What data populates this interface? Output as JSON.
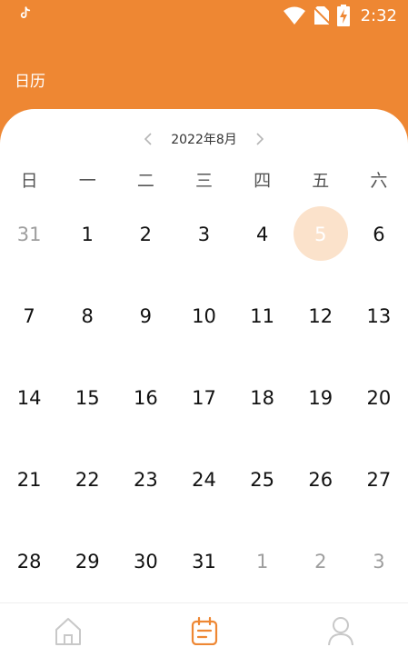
{
  "status_bar": {
    "time": "2:32"
  },
  "header": {
    "title": "日历"
  },
  "calendar": {
    "month_label": "2022年8月",
    "weekdays": [
      "日",
      "一",
      "二",
      "三",
      "四",
      "五",
      "六"
    ],
    "selected_day": "5",
    "days": [
      "31",
      "1",
      "2",
      "3",
      "4",
      "5",
      "6",
      "7",
      "8",
      "9",
      "10",
      "11",
      "12",
      "13",
      "14",
      "15",
      "16",
      "17",
      "18",
      "19",
      "20",
      "21",
      "22",
      "23",
      "24",
      "25",
      "26",
      "27",
      "28",
      "29",
      "30",
      "31",
      "1",
      "2",
      "3"
    ]
  },
  "colors": {
    "accent": "#EE8733",
    "selected_bg": "#FBE2CB",
    "muted_text": "#9e9e9e"
  },
  "bottom_nav": {
    "items": [
      {
        "icon": "home-icon"
      },
      {
        "icon": "calendar-icon",
        "active": true
      },
      {
        "icon": "profile-icon"
      }
    ]
  }
}
